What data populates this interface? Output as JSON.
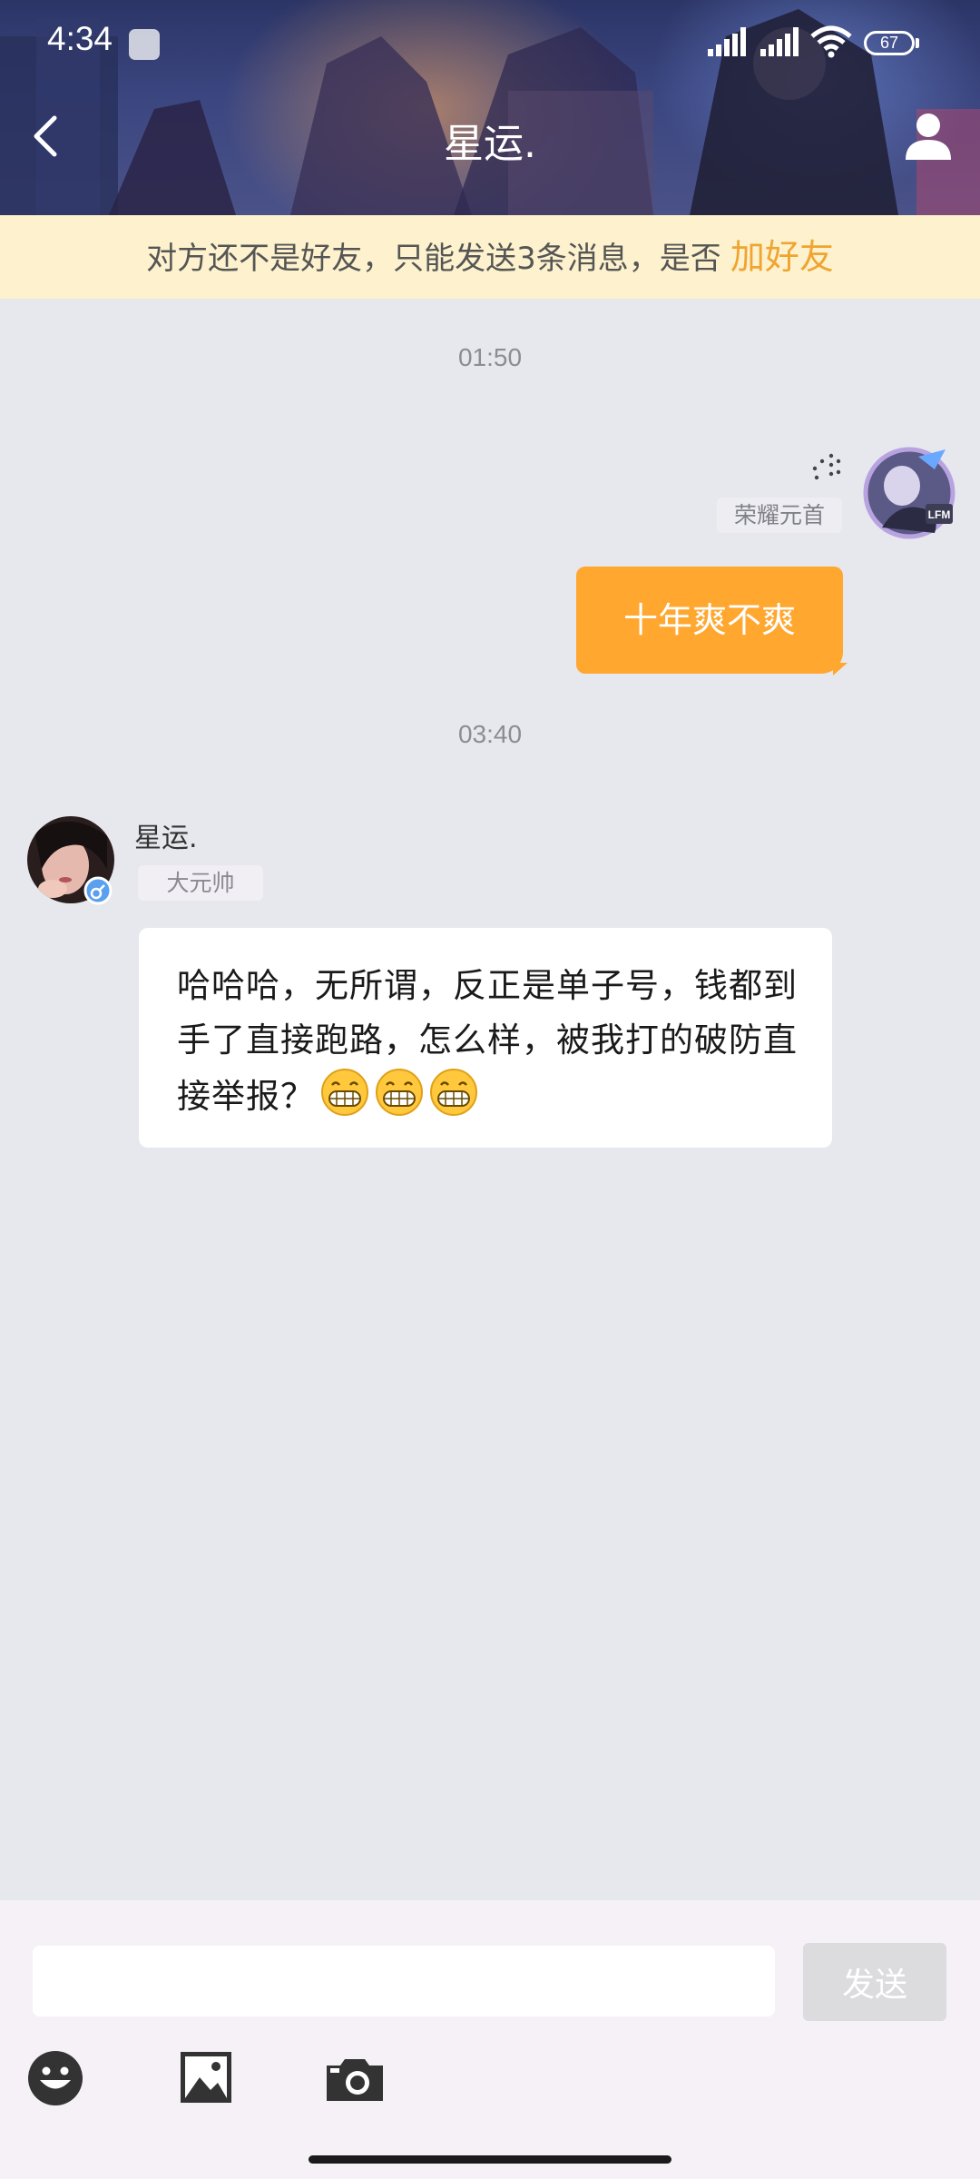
{
  "status_bar": {
    "time": "4:34",
    "battery": "67"
  },
  "header": {
    "title": "星运."
  },
  "notice": {
    "text": "对方还不是好友，只能发送3条消息，是否",
    "link": "加好友"
  },
  "messages": [
    {
      "timestamp": "01:50",
      "sender": "me",
      "rank": "荣耀元首",
      "text": "十年爽不爽"
    },
    {
      "timestamp": "03:40",
      "sender": "other",
      "name": "星运.",
      "rank": "大元帅",
      "text": "哈哈哈，无所谓，反正是单子号，钱都到手了直接跑路，怎么样，被我打的破防直接举报？",
      "emoji": [
        "grin-icon",
        "grin-icon",
        "grin-icon"
      ]
    }
  ],
  "input": {
    "value": "",
    "send_label": "发送"
  },
  "toolbar": {
    "icons": [
      "smiley-icon",
      "image-icon",
      "camera-icon"
    ]
  },
  "colors": {
    "accent": "#ffa72f",
    "notice_bg": "#fdf2cd",
    "link": "#f0a431",
    "chat_bg": "#e6e8ed"
  }
}
